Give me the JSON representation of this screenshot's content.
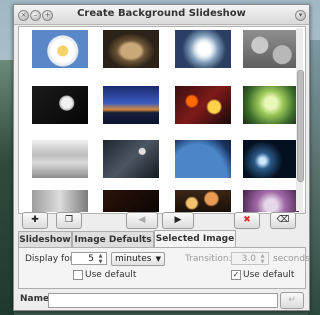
{
  "window": {
    "title": "Create Background Slideshow"
  },
  "toolbar": {
    "add_icon": "plus-icon",
    "duplicate_icon": "copy-icon",
    "back_icon": "arrow-left-icon",
    "forward_icon": "arrow-right-icon",
    "delete_icon": "x-red-icon",
    "clear_icon": "clear-icon"
  },
  "tabs": [
    {
      "label": "Slideshow"
    },
    {
      "label": "Image Defaults"
    },
    {
      "label": "Selected Image"
    }
  ],
  "selected_image": {
    "display_for_label": "Display for:",
    "display_for_value": "5",
    "unit": "minutes",
    "use_default_label_1": "Use default",
    "transition_label": "Transition:",
    "transition_value": "3.0",
    "transition_unit": "seconds",
    "use_default_label_2": "Use default",
    "use_default_2_checked": "✓"
  },
  "name_field": {
    "label": "Name:",
    "value": ""
  },
  "colors": {
    "accent": "#d93232",
    "window_bg": "#ededed"
  }
}
